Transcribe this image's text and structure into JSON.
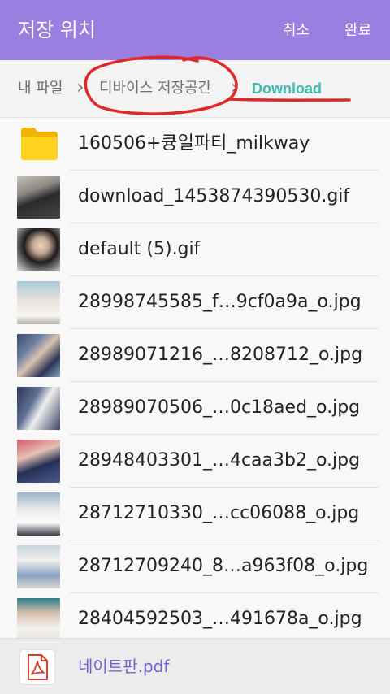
{
  "header": {
    "title": "저장 위치",
    "cancel_label": "취소",
    "done_label": "완료",
    "bg_color": "#9a7fe0"
  },
  "breadcrumb": {
    "items": [
      "내 파일",
      "디바이스 저장공간",
      "Download"
    ],
    "active_color": "#3bbfb4"
  },
  "files": [
    {
      "name": "160506+큥일파티_milkway",
      "type": "folder",
      "icon": "folder-icon"
    },
    {
      "name": "download_1453874390530.gif",
      "type": "image"
    },
    {
      "name": "default (5).gif",
      "type": "image"
    },
    {
      "name": "28998745585_f…9cf0a9a_o.jpg",
      "type": "image"
    },
    {
      "name": "28989071216_…8208712_o.jpg",
      "type": "image"
    },
    {
      "name": "28989070506_…0c18aed_o.jpg",
      "type": "image"
    },
    {
      "name": "28948403301_…4caa3b2_o.jpg",
      "type": "image"
    },
    {
      "name": "28712710330_…cc06088_o.jpg",
      "type": "image"
    },
    {
      "name": "28712709240_8…a963f08_o.jpg",
      "type": "image"
    },
    {
      "name": "28404592503_…491678a_o.jpg",
      "type": "image"
    }
  ],
  "bottom_file": {
    "name": "네이트판.pdf",
    "icon": "pdf-icon",
    "color": "#7a5fd0"
  }
}
